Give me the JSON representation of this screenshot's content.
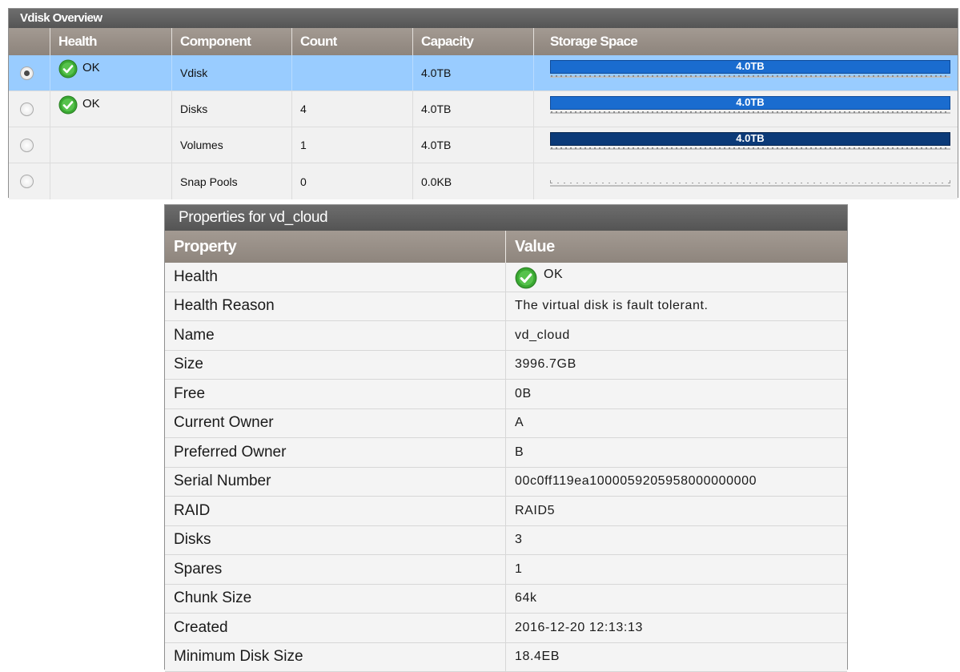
{
  "overview": {
    "title": "Vdisk Overview",
    "columns": [
      "Health",
      "Component",
      "Count",
      "Capacity",
      "Storage Space"
    ],
    "rows": [
      {
        "selected": true,
        "health": "OK",
        "component": "Vdisk",
        "count": "",
        "capacity": "4.0TB",
        "bar_label": "4.0TB",
        "bar_fraction": 1.0,
        "bar_style": "blue"
      },
      {
        "selected": false,
        "health": "OK",
        "component": "Disks",
        "count": "4",
        "capacity": "4.0TB",
        "bar_label": "4.0TB",
        "bar_fraction": 1.0,
        "bar_style": "blue"
      },
      {
        "selected": false,
        "health": "",
        "component": "Volumes",
        "count": "1",
        "capacity": "4.0TB",
        "bar_label": "4.0TB",
        "bar_fraction": 1.0,
        "bar_style": "dark"
      },
      {
        "selected": false,
        "health": "",
        "component": "Snap Pools",
        "count": "0",
        "capacity": "0.0KB",
        "bar_label": "",
        "bar_fraction": 0.0,
        "bar_style": "none"
      }
    ]
  },
  "properties": {
    "title": "Properties for vd_cloud",
    "columns": [
      "Property",
      "Value"
    ],
    "rows": [
      {
        "key": "Health",
        "value": "OK",
        "icon": "ok-check-icon"
      },
      {
        "key": "Health Reason",
        "value": "The virtual disk is fault tolerant."
      },
      {
        "key": "Name",
        "value": "vd_cloud"
      },
      {
        "key": "Size",
        "value": "3996.7GB"
      },
      {
        "key": "Free",
        "value": "0B"
      },
      {
        "key": "Current Owner",
        "value": "A"
      },
      {
        "key": "Preferred Owner",
        "value": "B"
      },
      {
        "key": "Serial Number",
        "value": "00c0ff119ea1000059205958000000000"
      },
      {
        "key": "RAID",
        "value": "RAID5"
      },
      {
        "key": "Disks",
        "value": "3"
      },
      {
        "key": "Spares",
        "value": "1"
      },
      {
        "key": "Chunk Size",
        "value": "64k"
      },
      {
        "key": "Created",
        "value": "2016-12-20 12:13:13"
      },
      {
        "key": "Minimum Disk Size",
        "value": "18.4EB"
      }
    ]
  },
  "colors": {
    "selected_row": "#99ccff",
    "bar_blue": "#1a6ccf",
    "bar_dark": "#0b3a78",
    "ok_green": "#3aa832",
    "header_taupe": "#998f87",
    "title_bar": "#5f5f5f"
  }
}
